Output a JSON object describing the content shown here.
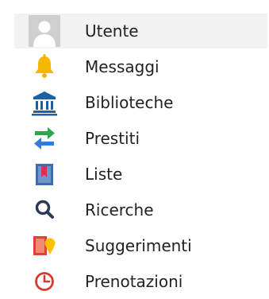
{
  "menu": {
    "items": [
      {
        "label": "Utente",
        "icon": "user-avatar-icon",
        "active": true
      },
      {
        "label": "Messaggi",
        "icon": "bell-icon",
        "active": false
      },
      {
        "label": "Biblioteche",
        "icon": "library-building-icon",
        "active": false
      },
      {
        "label": "Prestiti",
        "icon": "swap-arrows-icon",
        "active": false
      },
      {
        "label": "Liste",
        "icon": "bookmark-list-icon",
        "active": false
      },
      {
        "label": "Ricerche",
        "icon": "search-icon",
        "active": false
      },
      {
        "label": "Suggerimenti",
        "icon": "suggestion-icon",
        "active": false
      },
      {
        "label": "Prenotazioni",
        "icon": "clock-icon",
        "active": false
      }
    ]
  },
  "colors": {
    "active_background": "#f2f2f2",
    "text": "#222222",
    "avatar": "#cfcfcf",
    "bell": "#f5b800",
    "library": "#1f5fa8",
    "swap_green": "#2aa84a",
    "swap_blue": "#2f7fd6",
    "list": "#3b6db3",
    "list_accent": "#d8334a",
    "search": "#2b3a55",
    "suggestion_red": "#d64532",
    "suggestion_yellow": "#ffc107",
    "clock": "#d93a2f"
  }
}
